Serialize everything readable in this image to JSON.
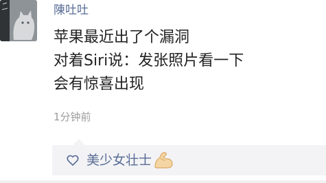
{
  "post": {
    "username": "陳吐吐",
    "content_lines": [
      "苹果最近出了个漏洞",
      "对着Siri说：发张照片看一下",
      "会有惊喜出现"
    ],
    "timestamp": "1分钟前"
  },
  "likes": {
    "icon": "heart-outline-icon",
    "liker_name": "美少女壮士",
    "emoji": "flexed-biceps-emoji"
  },
  "colors": {
    "link_blue": "#576b95",
    "text": "#222222",
    "meta_gray": "#9b9b9b",
    "likes_bg": "#f3f3f5"
  }
}
